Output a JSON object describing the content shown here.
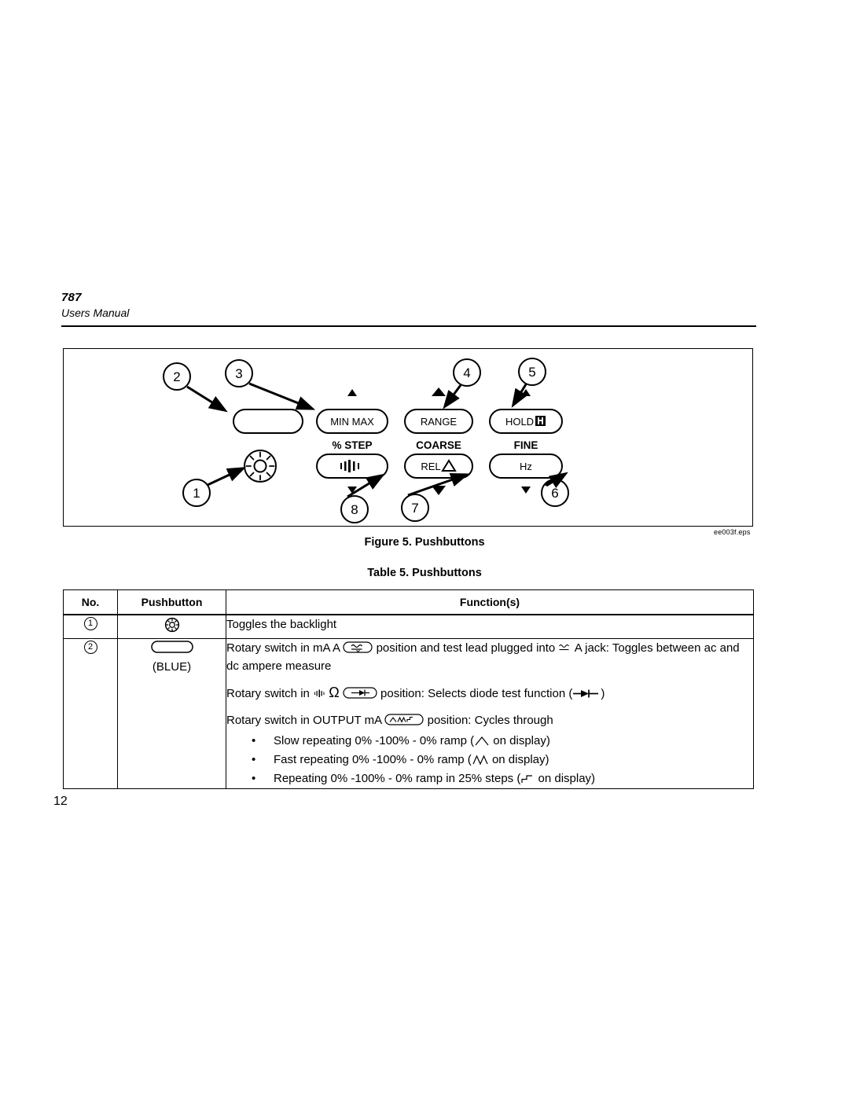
{
  "header": {
    "model": "787",
    "subtitle": "Users Manual"
  },
  "figure": {
    "caption": "Figure 5. Pushbuttons",
    "eps_label": "ee003f.eps",
    "callouts": [
      {
        "id": "1",
        "label": "1"
      },
      {
        "id": "2",
        "label": "2"
      },
      {
        "id": "3",
        "label": "3"
      },
      {
        "id": "4",
        "label": "4"
      },
      {
        "id": "5",
        "label": "5"
      },
      {
        "id": "6",
        "label": "6"
      },
      {
        "id": "7",
        "label": "7"
      },
      {
        "id": "8",
        "label": "8"
      }
    ],
    "buttons": {
      "blank_blue": "",
      "min_max": "MIN MAX",
      "range": "RANGE",
      "hold": "HOLD",
      "beeper_icon": "beeper-icon",
      "rel": "REL",
      "hz": "Hz",
      "backlight_icon": "backlight-icon",
      "hold_icon": "hold-h-icon"
    },
    "sublabels": {
      "percent_step": "% STEP",
      "coarse": "COARSE",
      "fine": "FINE"
    }
  },
  "table": {
    "caption": "Table 5. Pushbuttons",
    "headers": {
      "no": "No.",
      "pushbutton": "Pushbutton",
      "functions": "Function(s)"
    },
    "rows": [
      {
        "no": "1",
        "pushbutton_icon": "backlight-icon",
        "pushbutton_label": "",
        "function_text": "Toggles the backlight"
      },
      {
        "no": "2",
        "pushbutton_icon": "blank-button-icon",
        "pushbutton_label": "(BLUE)",
        "line1_a": "Rotary switch in mA A",
        "line1_b": "position and test lead plugged into",
        "line1_c": "A jack: Toggles between ac and dc ampere measure",
        "line2_a": "Rotary switch in",
        "line2_ohm": "Ω",
        "line2_b": "position: Selects diode test function (",
        "line2_c": ")",
        "line3_a": "Rotary switch in OUTPUT mA",
        "line3_b": "position: Cycles through",
        "bullets": [
          {
            "dot": "•",
            "before": "Slow repeating 0% -100% - 0% ramp (",
            "after": "on display)"
          },
          {
            "dot": "•",
            "before": "Fast repeating 0% -100% - 0% ramp (",
            "after": "on display)"
          },
          {
            "dot": "•",
            "before": "Repeating 0% -100% - 0% ramp in 25% steps (",
            "after": "on display)"
          }
        ]
      }
    ]
  },
  "footer": {
    "page_number": "12"
  }
}
